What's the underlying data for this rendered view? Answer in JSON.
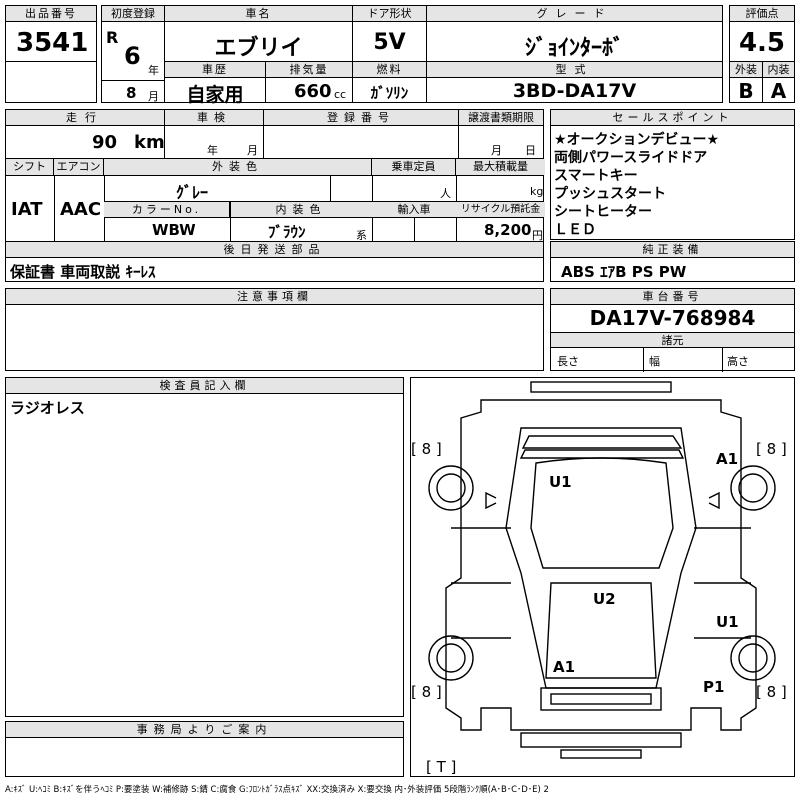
{
  "top": {
    "lot_no_label": "出品番号",
    "lot_no": "3541",
    "first_reg_label": "初度登録",
    "era": "R",
    "year": "6",
    "year_unit": "年",
    "month": "8",
    "month_unit": "月",
    "car_name_label": "車名",
    "car_name": "エブリイ",
    "history_label": "車歴",
    "history": "自家用",
    "displacement_label": "排気量",
    "displacement": "660",
    "displacement_unit": "cc",
    "door_label": "ドア形状",
    "door": "5V",
    "fuel_label": "燃料",
    "fuel": "ｶﾞｿﾘﾝ",
    "grade_label": "グレード",
    "grade": "ｼﾞｮｲﾝﾀｰﾎﾞ",
    "model_label": "型式",
    "model": "3BD-DA17V",
    "score_label": "評価点",
    "score": "4.5",
    "exterior_label": "外装",
    "exterior": "B",
    "interior_label": "内装",
    "interior": "A"
  },
  "mid": {
    "mileage_label": "走行",
    "mileage": "90",
    "mileage_unit": "km",
    "inspection_label": "車検",
    "year_unit": "年",
    "month_unit": "月",
    "reg_no_label": "登録番号",
    "transfer_label": "譲渡書類期限",
    "shift_label": "シフト",
    "shift": "IAT",
    "ac_label": "エアコン",
    "ac": "AAC",
    "ext_color_label": "外装色",
    "ext_color": "ｸﾞﾚｰ",
    "capacity_label": "乗車定員",
    "capacity_unit": "人",
    "load_label": "最大積載量",
    "load_unit": "kg",
    "color_no_label": "カラーNo.",
    "color_no": "WBW",
    "int_color_label": "内装色",
    "int_color": "ﾌﾞﾗｳﾝ",
    "int_color_suffix": "系",
    "import_label": "輸入車",
    "recycle_label": "リサイクル預託金",
    "recycle": "8,200",
    "recycle_unit": "円",
    "later_label": "後日発送部品",
    "later_items": "保証書 車両取説 ｷｰﾚｽ"
  },
  "sales": {
    "label": "セールスポイント",
    "lines": [
      "★オークションデビュー★",
      "両側パワースライドドア",
      "スマートキー",
      "プッシュスタート",
      "シートヒーター",
      "ＬＥＤ"
    ]
  },
  "equipment": {
    "label": "純正装備",
    "value": "ABS ｴｱB PS PW"
  },
  "notes": {
    "label": "注意事項欄"
  },
  "chassis": {
    "label": "車台番号",
    "value": "DA17V-768984",
    "spec_label": "諸元",
    "length_label": "長さ",
    "width_label": "幅",
    "height_label": "高さ"
  },
  "inspector": {
    "label": "検査員記入欄",
    "text": "ラジオレス"
  },
  "office": {
    "label": "事務局よりご案内"
  },
  "diagram": {
    "marks": {
      "u1_top": "U1",
      "a1_fr": "A1",
      "u2": "U2",
      "u1_rr": "U1",
      "a1_rear": "A1",
      "p1": "P1"
    },
    "tires": {
      "fl": "[ 8 ]",
      "fr": "[ 8 ]",
      "rl": "[ 8 ]",
      "rr": "[ 8 ]",
      "spare": "[ T ]"
    }
  },
  "legend": "A:ｷｽﾞ U:ﾍｺﾐ B:ｷｽﾞを伴うﾍｺﾐ P:要塗装 W:補修跡 S:錆 C:腐食 G:ﾌﾛﾝﾄｶﾞﾗｽ点ｷｽﾞ XX:交換済み X:要交換 内･外装評価 5段階ﾗﾝｸ順(A･B･C･D･E) 2"
}
